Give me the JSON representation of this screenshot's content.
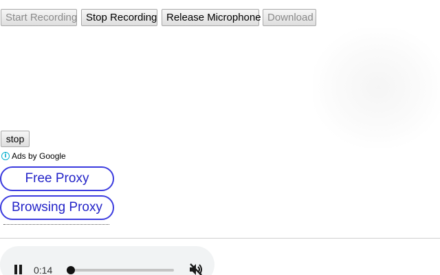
{
  "toolbar": {
    "start_recording": "Start Recording",
    "stop_recording": "Stop Recording",
    "release_microphone": "Release Microphone",
    "download": "Download"
  },
  "stop_button": "stop",
  "ads": {
    "icon": "info-circle-icon",
    "label": "Ads by Google",
    "links": [
      "Free Proxy",
      "Browsing Proxy"
    ]
  },
  "audio_player": {
    "time": "0:14",
    "progress_fraction": 0.04,
    "play_state_icon": "pause-icon",
    "volume_icon": "muted-speaker-icon"
  },
  "colors": {
    "ad_link": "#2323c8",
    "ad_border": "#3a3adf",
    "ad_info": "#00aecd",
    "player_bg": "#f1f3f4"
  }
}
